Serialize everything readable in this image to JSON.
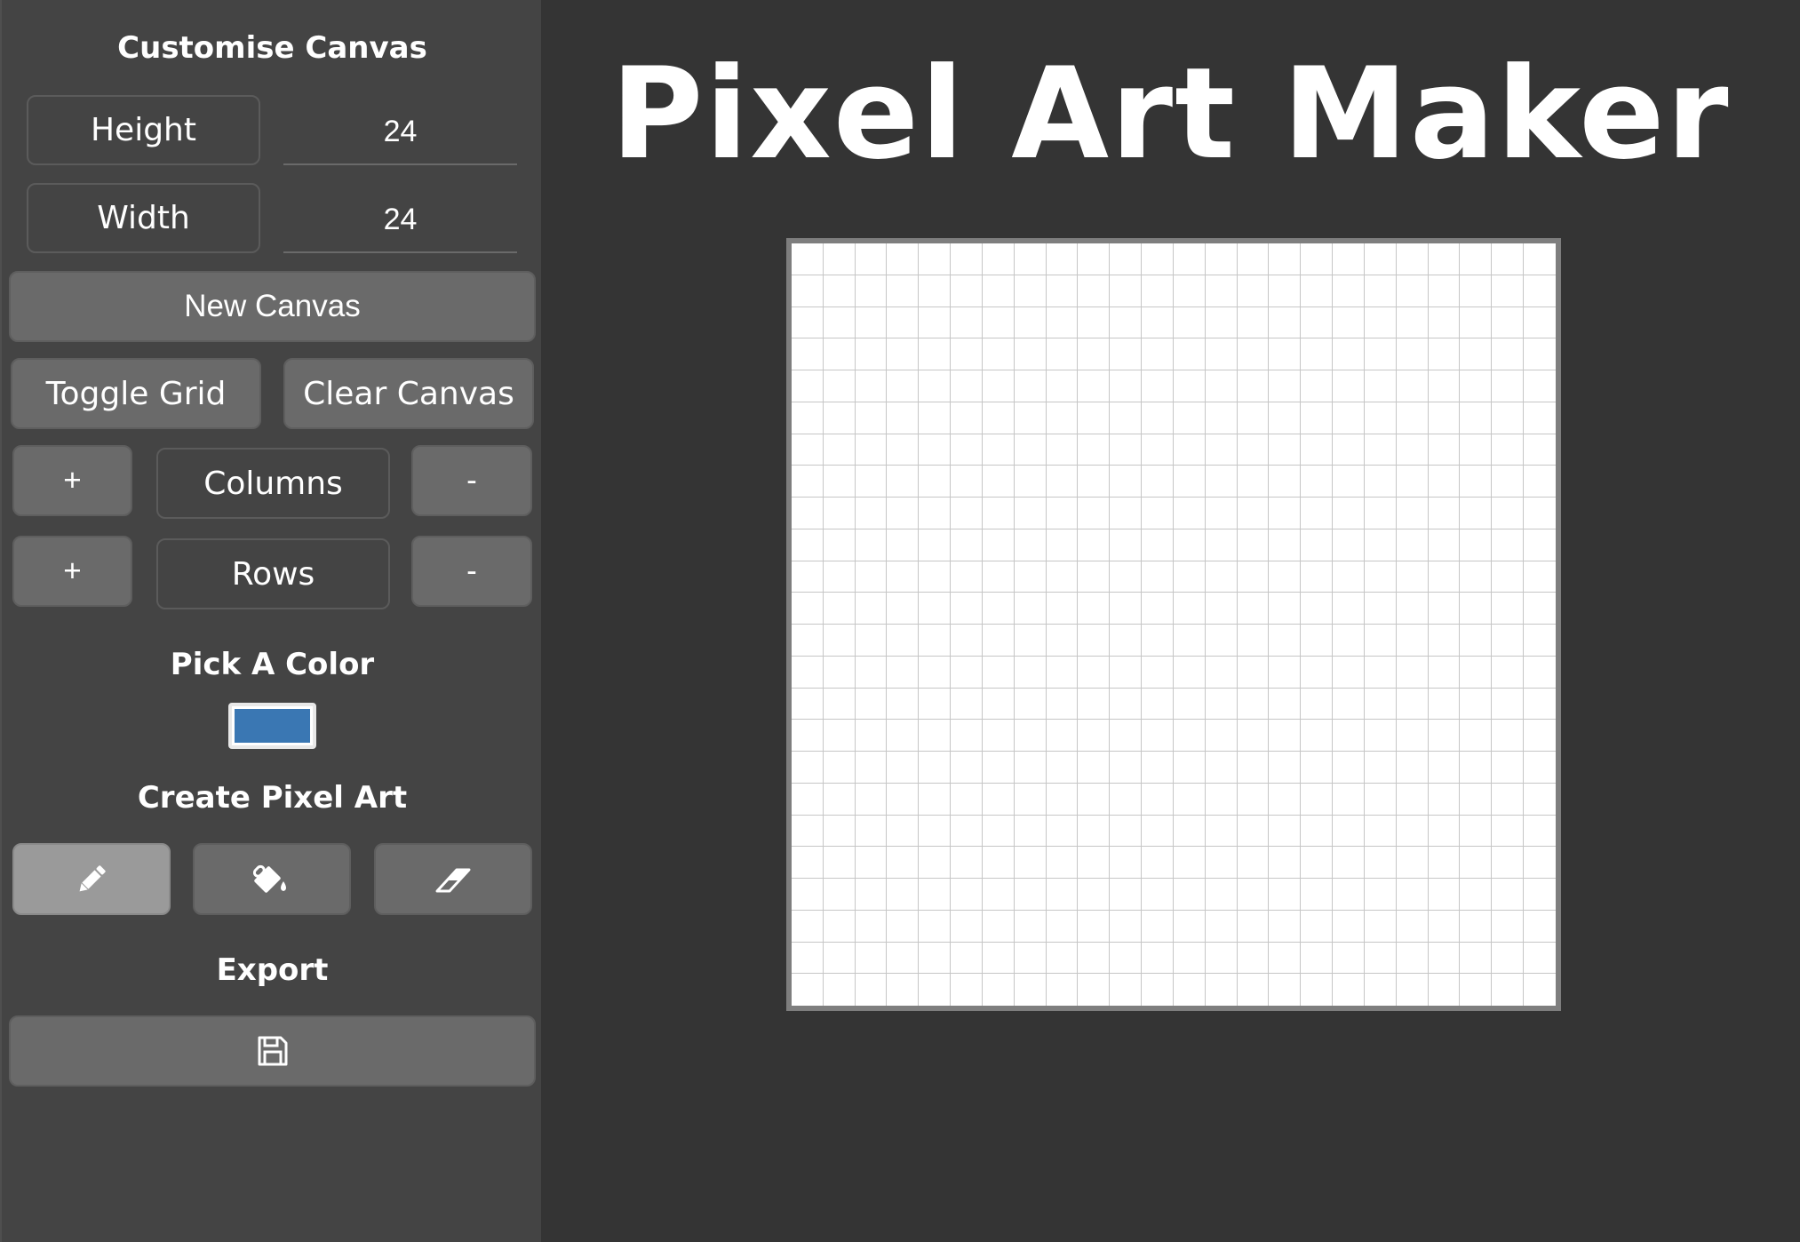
{
  "app": {
    "title": "Pixel Art Maker"
  },
  "customise": {
    "heading": "Customise Canvas",
    "height_label": "Height",
    "height_value": "24",
    "width_label": "Width",
    "width_value": "24",
    "new_canvas_label": "New Canvas",
    "toggle_grid_label": "Toggle Grid",
    "clear_canvas_label": "Clear Canvas",
    "columns": {
      "add_label": "+",
      "label": "Columns",
      "remove_label": "-"
    },
    "rows": {
      "add_label": "+",
      "label": "Rows",
      "remove_label": "-"
    }
  },
  "color": {
    "heading": "Pick A Color",
    "current": "#3a77b3"
  },
  "tools": {
    "heading": "Create Pixel Art",
    "items": [
      {
        "name": "pencil-icon",
        "active": true
      },
      {
        "name": "paint-bucket-icon",
        "active": false
      },
      {
        "name": "eraser-icon",
        "active": false
      }
    ]
  },
  "export": {
    "heading": "Export",
    "icon": "floppy-disk-icon"
  },
  "canvas": {
    "rows": 24,
    "columns": 24,
    "grid_visible": true,
    "cell_color": "#ffffff",
    "grid_color": "#c6c6c6"
  }
}
